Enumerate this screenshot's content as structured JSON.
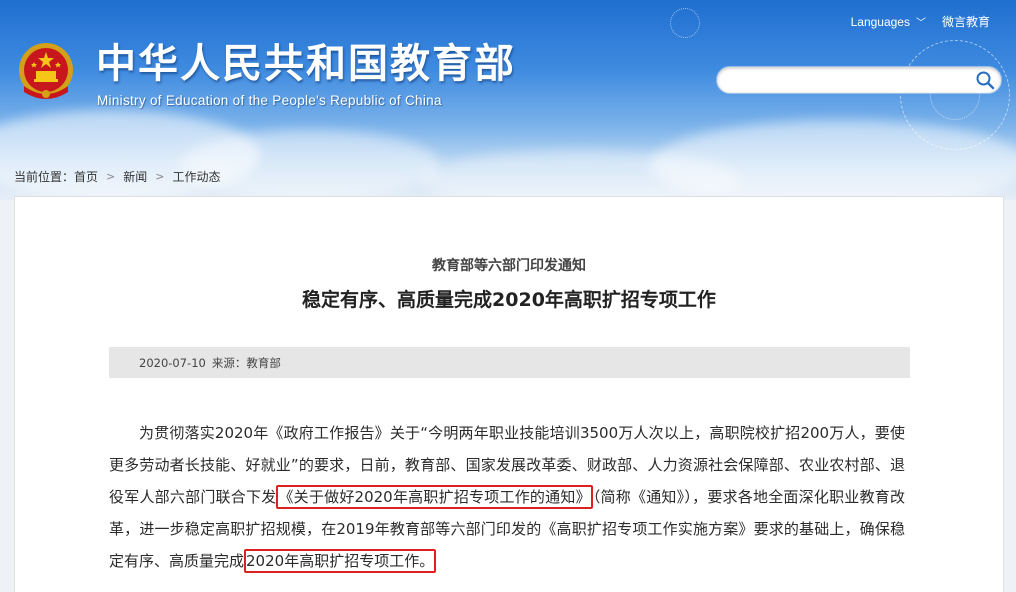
{
  "header": {
    "title_cn": "中华人民共和国教育部",
    "title_en": "Ministry of Education of the People's Republic of China",
    "languages_label": "Languages",
    "weibo_label": "微言教育",
    "search": {
      "value": "",
      "placeholder": ""
    }
  },
  "breadcrumb": {
    "prefix": "当前位置：",
    "items": [
      "首页",
      "新闻",
      "工作动态"
    ],
    "separator": ">"
  },
  "article": {
    "subhead": "教育部等六部门印发通知",
    "headline": "稳定有序、高质量完成2020年高职扩招专项工作",
    "meta": {
      "date": "2020-07-10",
      "source_label": "来源：",
      "source": "教育部"
    },
    "body": {
      "part1": "为贯彻落实2020年《政府工作报告》关于“今明两年职业技能培训3500万人次以上，高职院校扩招200万人，要使更多劳动者长技能、好就业”的要求，日前，教育部、国家发展改革委、财政部、人力资源社会保障部、农业农村部、退役军人部六部门联合下发",
      "highlight1": "《关于做好2020年高职扩招专项工作的通知》",
      "part2": "（简称《通知》），要求各地全面深化职业教育改革，进一步稳定高职扩招规模，在2019年教育部等六部门印发的《高职扩招专项工作实施方案》要求的基础上，确保稳定有序、高质量完成",
      "highlight2": "2020年高职扩招专项工作。"
    }
  },
  "colors": {
    "banner_top": "#1f6fd0",
    "highlight_border": "#e02020",
    "meta_bar": "#e6e6e6"
  },
  "icons": [
    "national-emblem-icon",
    "search-icon",
    "chevron-down-icon"
  ]
}
